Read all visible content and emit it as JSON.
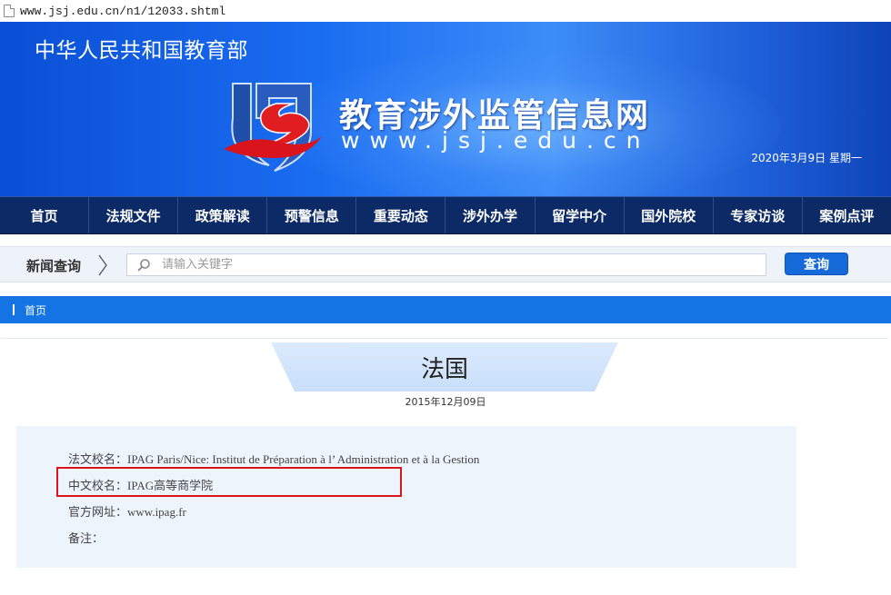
{
  "browser": {
    "url": "www.jsj.edu.cn/n1/12033.shtml"
  },
  "banner": {
    "ministry": "中华人民共和国教育部",
    "site_title": "教育涉外监管信息网",
    "site_url": "www.jsj.edu.cn",
    "date": "2020年3月9日  星期一",
    "colors": {
      "primary": "#1a6cf0",
      "logo_red": "#d9141c",
      "logo_blue": "#1f4fa8"
    }
  },
  "nav": {
    "items": [
      "首页",
      "法规文件",
      "政策解读",
      "预警信息",
      "重要动态",
      "涉外办学",
      "留学中介",
      "国外院校",
      "专家访谈",
      "案例点评"
    ]
  },
  "search": {
    "label": "新闻查询",
    "placeholder": "请输入关键字",
    "button": "查询"
  },
  "breadcrumb": {
    "home": "首页"
  },
  "article": {
    "title": "法国",
    "date": "2015年12月09日",
    "lines": [
      "法文校名：IPAG Paris/Nice: Institut de Préparation à l’ Administration et à la Gestion",
      "中文校名：IPAG高等商学院",
      "官方网址：www.ipag.fr",
      "备注："
    ],
    "highlight_color": "#d9141c"
  }
}
